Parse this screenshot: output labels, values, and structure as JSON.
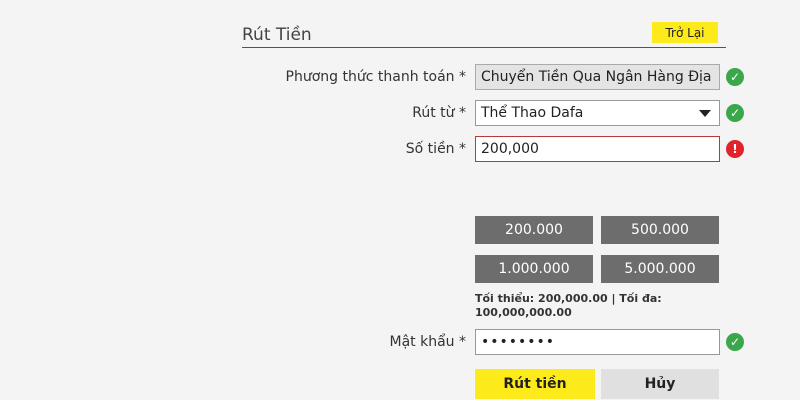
{
  "header": {
    "title": "Rút Tiền",
    "back_label": "Trở Lại"
  },
  "form": {
    "payment_method": {
      "label": "Phương thức thanh toán *",
      "value": "Chuyển Tiền Qua Ngân Hàng Địa",
      "status": "ok"
    },
    "withdraw_from": {
      "label": "Rút từ *",
      "value": "Thể Thao Dafa",
      "status": "ok"
    },
    "amount": {
      "label": "Số tiền *",
      "value": "200,000",
      "status": "error"
    },
    "quick_amounts": [
      "200.000",
      "500.000",
      "1.000.000",
      "5.000.000"
    ],
    "limits_text": "Tối thiểu: 200,000.00 | Tối đa: 100,000,000.00",
    "password": {
      "label": "Mật khẩu *",
      "value": "••••••••",
      "status": "ok"
    },
    "submit_label": "Rút tiền",
    "cancel_label": "Hủy"
  },
  "icons": {
    "ok": "check-circle-icon",
    "error": "exclamation-circle-icon"
  },
  "colors": {
    "accent_yellow": "#fdea1a",
    "ok_green": "#3aa84a",
    "error_red": "#e0242a",
    "amount_button": "#6d6d6d"
  }
}
